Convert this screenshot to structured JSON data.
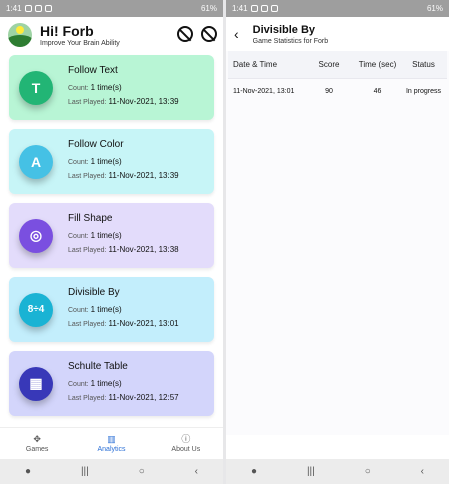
{
  "status_bar": {
    "time": "1:41",
    "signal": "61%"
  },
  "left": {
    "greeting": "Hi! Forb",
    "subtitle": "Improve Your Brain Ability",
    "cards": [
      {
        "name": "Follow Text",
        "count_label": "Count:",
        "count_value": "1 time(s)",
        "last_label": "Last Played:",
        "last_value": "11-Nov-2021, 13:39",
        "icon_text": "T",
        "icon": "text-icon"
      },
      {
        "name": "Follow Color",
        "count_label": "Count:",
        "count_value": "1 time(s)",
        "last_label": "Last Played:",
        "last_value": "11-Nov-2021, 13:39",
        "icon_text": "A",
        "icon": "color-icon"
      },
      {
        "name": "Fill Shape",
        "count_label": "Count:",
        "count_value": "1 time(s)",
        "last_label": "Last Played:",
        "last_value": "11-Nov-2021, 13:38",
        "icon_text": "◎",
        "icon": "shape-icon"
      },
      {
        "name": "Divisible By",
        "count_label": "Count:",
        "count_value": "1 time(s)",
        "last_label": "Last Played:",
        "last_value": "11-Nov-2021, 13:01",
        "icon_text": "8÷4",
        "icon": "math-icon"
      },
      {
        "name": "Schulte Table",
        "count_label": "Count:",
        "count_value": "1 time(s)",
        "last_label": "Last Played:",
        "last_value": "11-Nov-2021, 12:57",
        "icon_text": "▦",
        "icon": "grid-icon"
      }
    ],
    "tabs": [
      {
        "label": "Games",
        "icon": "gamepad-icon"
      },
      {
        "label": "Analytics",
        "icon": "chart-icon"
      },
      {
        "label": "About Us",
        "icon": "info-icon"
      }
    ]
  },
  "right": {
    "title": "Divisible By",
    "subtitle": "Game Statistics for Forb",
    "table": {
      "headers": [
        "Date & Time",
        "Score",
        "Time (sec)",
        "Status"
      ],
      "rows": [
        [
          "11-Nov-2021, 13:01",
          "90",
          "46",
          "In progress"
        ]
      ]
    }
  },
  "colors": {
    "accent": "#2a6fd6"
  }
}
